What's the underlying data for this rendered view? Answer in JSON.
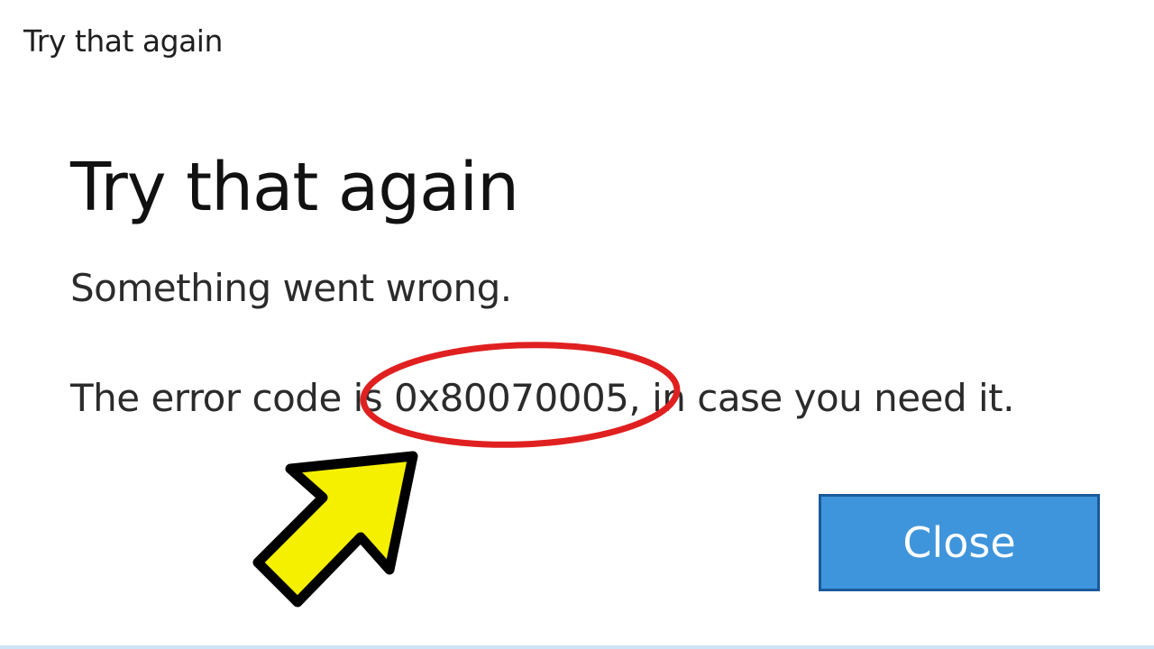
{
  "window": {
    "title": "Try that again"
  },
  "dialog": {
    "heading": "Try that again",
    "message": "Something went wrong.",
    "error_line": "The error code is 0x80070005, in case you need it.",
    "close_label": "Close"
  },
  "colors": {
    "button_fill": "#3f95dc",
    "button_border": "#1a5a9a",
    "highlight_circle": "#e02020",
    "arrow_fill": "#f5f000",
    "arrow_outline": "#000000"
  },
  "annotations": {
    "circle_icon": "red-ellipse-highlight-icon",
    "arrow_icon": "yellow-arrow-pointer-icon"
  }
}
